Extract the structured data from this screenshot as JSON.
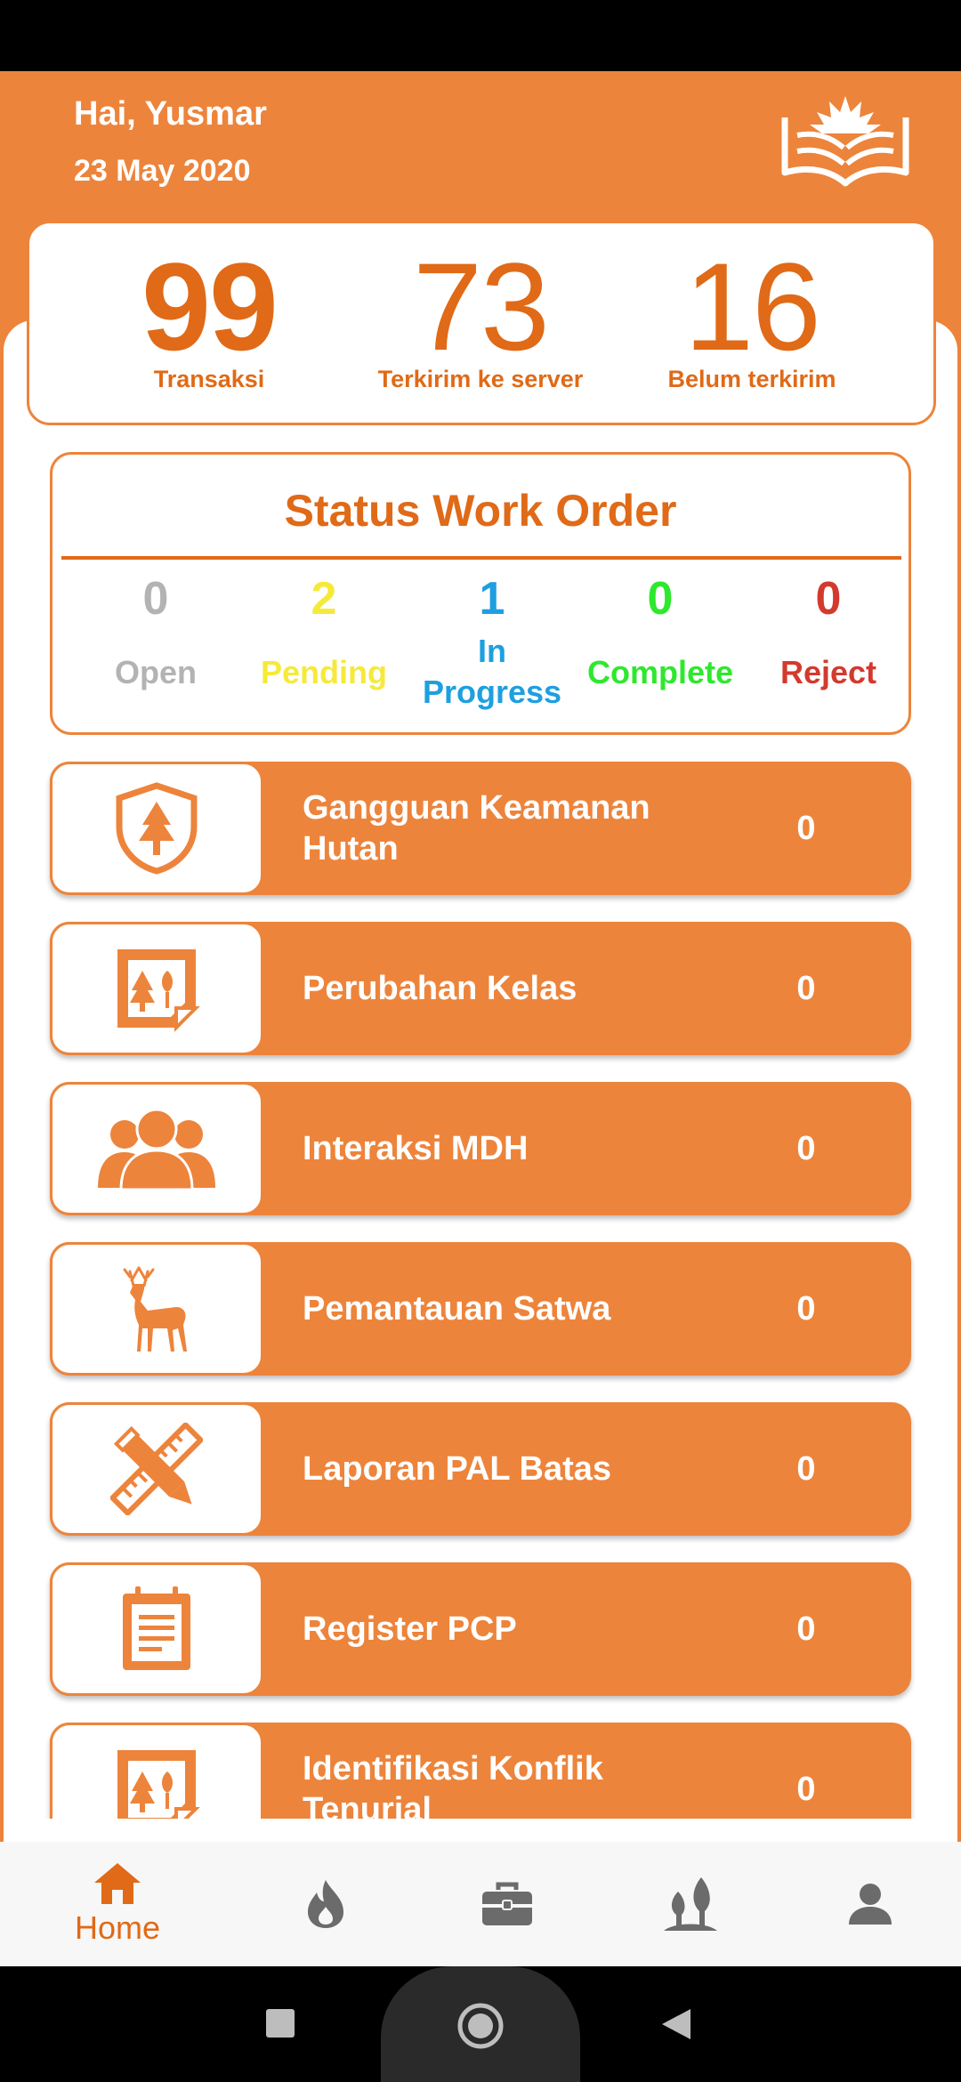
{
  "header": {
    "greeting": "Hai, Yusmar",
    "date": "23 May 2020"
  },
  "stats": [
    {
      "value": "99",
      "label": "Transaksi"
    },
    {
      "value": "73",
      "label": "Terkirim ke server"
    },
    {
      "value": "16",
      "label": "Belum terkirim"
    }
  ],
  "work_order": {
    "title": "Status Work Order",
    "items": [
      {
        "count": "0",
        "label": "Open",
        "color": "#B3B3B3"
      },
      {
        "count": "2",
        "label": "Pending",
        "color": "#F5EA3A"
      },
      {
        "count": "1",
        "label": "In Progress",
        "label_line1": "In",
        "label_line2": "Progress",
        "color": "#1E9FE0"
      },
      {
        "count": "0",
        "label": "Complete",
        "color": "#2EE82E"
      },
      {
        "count": "0",
        "label": "Reject",
        "color": "#D33A2E"
      }
    ]
  },
  "menu": [
    {
      "label": "Gangguan Keamanan Hutan",
      "count": "0",
      "icon": "forest-shield-icon"
    },
    {
      "label": "Perubahan Kelas",
      "count": "0",
      "icon": "tree-document-icon"
    },
    {
      "label": "Interaksi MDH",
      "count": "0",
      "icon": "people-group-icon"
    },
    {
      "label": "Pemantauan Satwa",
      "count": "0",
      "icon": "deer-icon"
    },
    {
      "label": "Laporan PAL Batas",
      "count": "0",
      "icon": "pencil-ruler-icon"
    },
    {
      "label": "Register PCP",
      "count": "0",
      "icon": "clipboard-icon"
    },
    {
      "label": "Identifikasi Konflik Tenurial",
      "count": "0",
      "icon": "tree-document-icon"
    }
  ],
  "bottom_nav": [
    {
      "label": "Home",
      "icon": "home-icon",
      "active": true
    },
    {
      "label": "",
      "icon": "fire-icon"
    },
    {
      "label": "",
      "icon": "briefcase-icon"
    },
    {
      "label": "",
      "icon": "trees-icon"
    },
    {
      "label": "",
      "icon": "profile-icon"
    }
  ],
  "colors": {
    "accent": "#ED843B",
    "accent_text": "#E06A17",
    "nav_inactive": "#6B6B6B"
  }
}
